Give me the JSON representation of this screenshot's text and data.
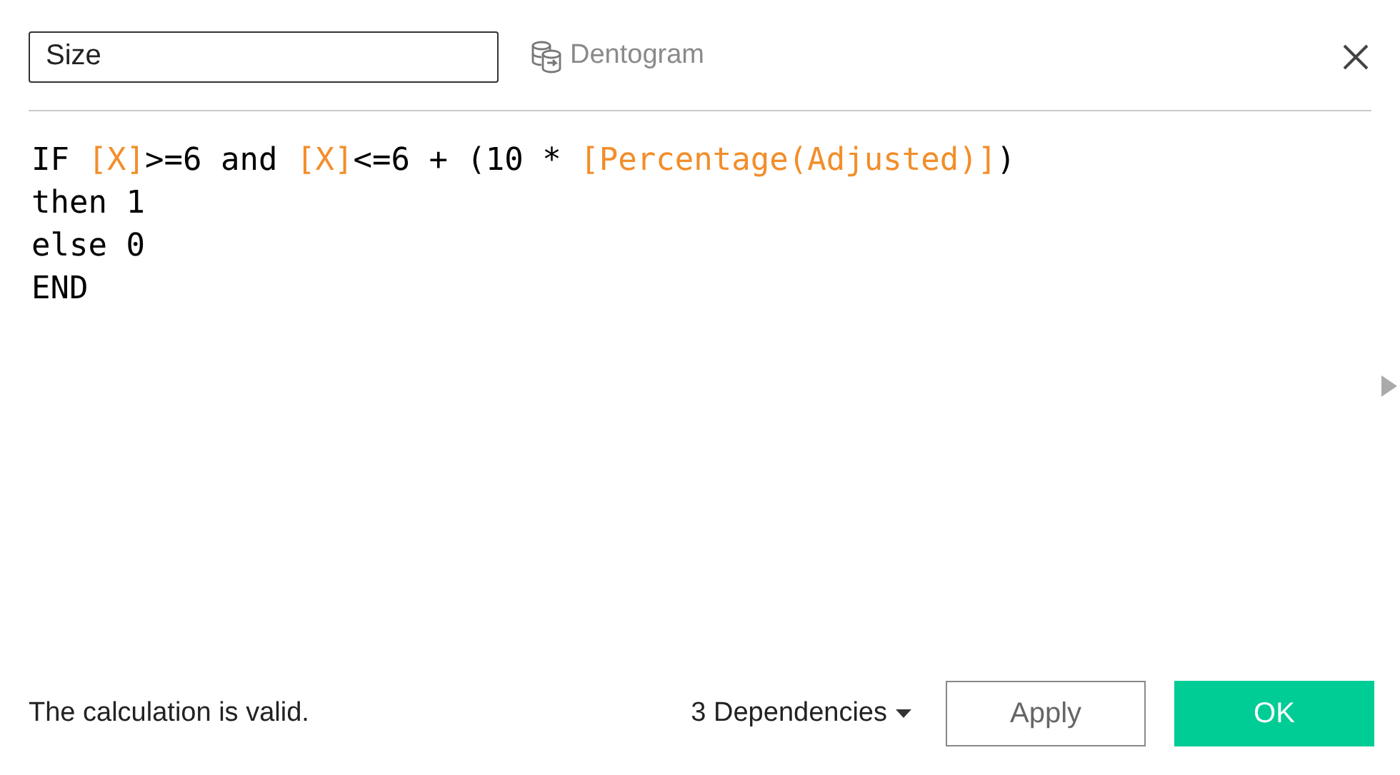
{
  "name_field": {
    "value": "Size"
  },
  "data_source": {
    "label": "Dentogram"
  },
  "code_lines": [
    [
      {
        "kind": "plain",
        "text": "IF "
      },
      {
        "kind": "field",
        "text": "[X]"
      },
      {
        "kind": "plain",
        "text": ">=6 and "
      },
      {
        "kind": "field",
        "text": "[X]"
      },
      {
        "kind": "plain",
        "text": "<=6 + (10 * "
      },
      {
        "kind": "field",
        "text": "[Percentage(Adjusted)]"
      },
      {
        "kind": "plain",
        "text": ")"
      }
    ],
    [
      {
        "kind": "plain",
        "text": "then 1"
      }
    ],
    [
      {
        "kind": "plain",
        "text": "else 0"
      }
    ],
    [
      {
        "kind": "plain",
        "text": "END"
      }
    ]
  ],
  "status": "The calculation is valid.",
  "dependencies": "3 Dependencies",
  "buttons": [
    {
      "label": "Apply",
      "kind": "secondary"
    },
    {
      "label": "OK",
      "kind": "primary"
    }
  ]
}
